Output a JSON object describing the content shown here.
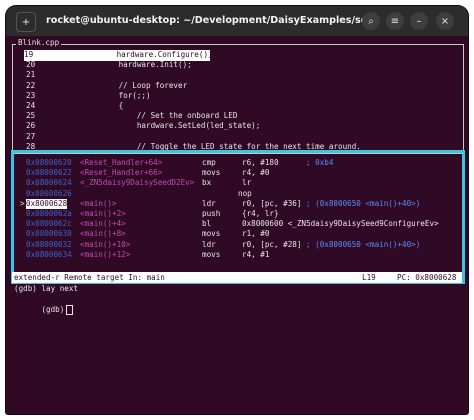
{
  "window": {
    "title": "rocket@ubuntu-desktop: ~/Development/DaisyExamples/seed/Blink",
    "new_tab_icon": "new-tab-icon",
    "search_icon": "⌕",
    "menu_icon": "≡",
    "minimize_icon": "–",
    "close_icon": "×"
  },
  "source": {
    "file_label": "Blink.cpp",
    "lines": [
      {
        "ln": "19",
        "code": "        hardware.Configure();",
        "current": true
      },
      {
        "ln": "20",
        "code": "        hardware.Init();"
      },
      {
        "ln": "21",
        "code": ""
      },
      {
        "ln": "22",
        "code": "        // Loop forever"
      },
      {
        "ln": "23",
        "code": "        for(;;)"
      },
      {
        "ln": "24",
        "code": "        {"
      },
      {
        "ln": "25",
        "code": "            // Set the onboard LED"
      },
      {
        "ln": "26",
        "code": "            hardware.SetLed(led_state);"
      },
      {
        "ln": "27",
        "code": ""
      },
      {
        "ln": "28",
        "code": "            // Toggle the LED state for the next time around."
      }
    ]
  },
  "asm": {
    "lines": [
      {
        "marker": "",
        "addr": "0x08000620",
        "fn": "<Reset_Handler+64>",
        "op": "cmp",
        "args": "r6, #180",
        "comment": "; 0xb4"
      },
      {
        "marker": "",
        "addr": "0x08000622",
        "fn": "<Reset_Handler+66>",
        "op": "movs",
        "args": "r4, #0",
        "comment": ""
      },
      {
        "marker": "",
        "addr": "0x08000624",
        "fn": "<_ZN5daisy9DaisySeedD2Ev>",
        "op": "bx",
        "args": "lr",
        "comment": ""
      },
      {
        "marker": "",
        "addr": "0x08000626",
        "fn": "",
        "op": "",
        "args": "nop",
        "comment": ""
      },
      {
        "marker": ">",
        "addr": "0x8000628",
        "fn": "<main()>",
        "op": "ldr",
        "args": "r0, [pc, #36]",
        "comment": "; (0x8000650 <main()+40>)",
        "current": true
      },
      {
        "marker": "",
        "addr": "0x0800062a",
        "fn": "<main()+2>",
        "op": "push",
        "args": "{r4, lr}",
        "comment": ""
      },
      {
        "marker": "",
        "addr": "0x0800062c",
        "fn": "<main()+4>",
        "op": "bl",
        "args": "0x8000600 <_ZN5daisy9DaisySeed9ConfigureEv>",
        "comment": ""
      },
      {
        "marker": "",
        "addr": "0x08000630",
        "fn": "<main()+8>",
        "op": "movs",
        "args": "r1, #0",
        "comment": ""
      },
      {
        "marker": "",
        "addr": "0x08000632",
        "fn": "<main()+10>",
        "op": "ldr",
        "args": "r0, [pc, #28]",
        "comment": "; (0x8000650 <main()+40>)"
      },
      {
        "marker": "",
        "addr": "0x08000634",
        "fn": "<main()+12>",
        "op": "movs",
        "args": "r4, #1",
        "comment": ""
      }
    ]
  },
  "status": {
    "target": "extended-r Remote target In: main",
    "line": "L19",
    "pc": "PC: 0x8000628"
  },
  "console": {
    "line1": "(gdb) lay next",
    "prompt": "(gdb)"
  }
}
